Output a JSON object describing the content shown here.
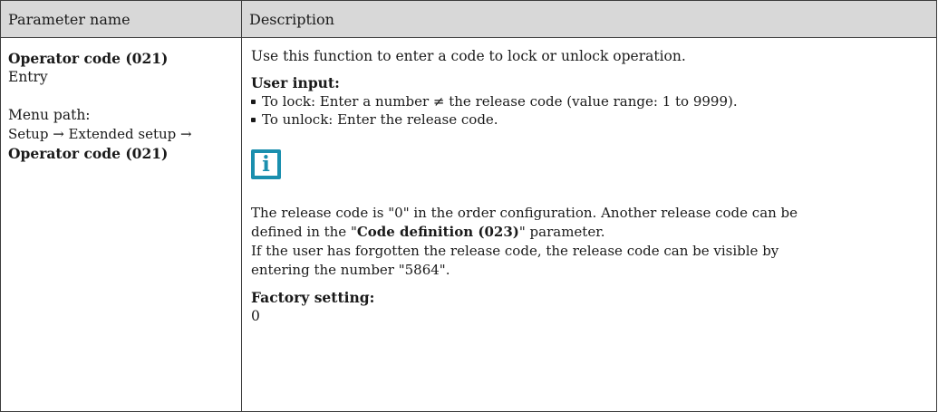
{
  "header": {
    "col1": "Parameter name",
    "col2": "Description"
  },
  "left": {
    "param_name": "Operator code (021)",
    "access": "Entry",
    "menu_path_label": "Menu path:",
    "menu_path_line1": "Setup → Extended setup →",
    "menu_path_line2": "Operator code (021)"
  },
  "right": {
    "intro": "Use this function to enter a code to lock or unlock operation.",
    "user_input_label": "User input:",
    "bullets": [
      "To lock: Enter a number ≠ the release code (value range: 1 to 9999).",
      "To unlock: Enter the release code."
    ],
    "info_icon": "info-icon",
    "note_a_pre": "The release code is \"0\" in the order configuration. Another release code can be",
    "note_b_pre": "defined in the \"",
    "note_b_bold": "Code definition (023)",
    "note_b_post": "\" parameter.",
    "note_c": "If the user has forgotten the release code, the release code can be visible by",
    "note_d": "entering the number \"5864\".",
    "factory_label": "Factory setting:",
    "factory_value": "0"
  },
  "colors": {
    "header_bg": "#d8d8d8",
    "border": "#3c3c3c",
    "info_icon": "#1a8fae"
  }
}
